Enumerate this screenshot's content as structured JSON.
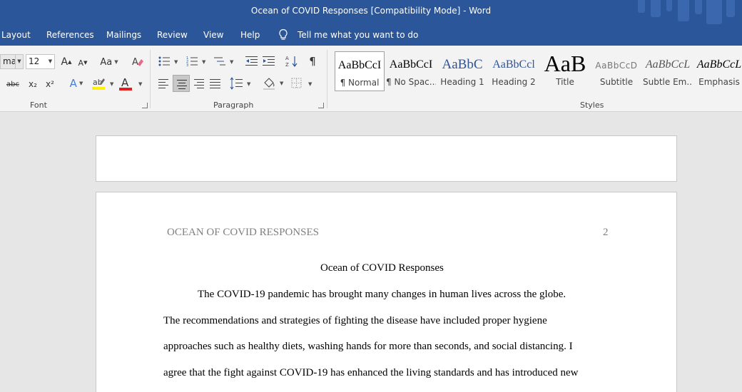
{
  "window": {
    "title": "Ocean of COVID Responses [Compatibility Mode]  -  Word"
  },
  "menu": {
    "items": [
      "Layout",
      "References",
      "Mailings",
      "Review",
      "View",
      "Help"
    ],
    "tell_me": "Tell me what you want to do"
  },
  "ribbon": {
    "font": {
      "name": "ma",
      "size": "12",
      "group_label": "Font"
    },
    "paragraph": {
      "group_label": "Paragraph"
    },
    "styles": {
      "group_label": "Styles",
      "items": [
        {
          "preview": "AaBbCcI",
          "name": "¶ Normal"
        },
        {
          "preview": "AaBbCcI",
          "name": "¶ No Spac..."
        },
        {
          "preview": "AaBbC",
          "name": "Heading 1"
        },
        {
          "preview": "AaBbCcl",
          "name": "Heading 2"
        },
        {
          "preview": "AaB",
          "name": "Title"
        },
        {
          "preview": "AaBbCcD",
          "name": "Subtitle"
        },
        {
          "preview": "AaBbCcL",
          "name": "Subtle Em..."
        },
        {
          "preview": "AaBbCcL",
          "name": "Emphasis"
        }
      ]
    },
    "glyphs": {
      "grow": "A",
      "shrink": "A",
      "case": "Aa",
      "strike": "abc",
      "sub": "x₂",
      "sup": "x²",
      "text_effect": "A",
      "font_color": "A",
      "pilcrow": "¶"
    }
  },
  "colors": {
    "brand": "#2b579a",
    "font_color_bar": "#e02020",
    "highlight_bar": "#ffef00"
  },
  "document": {
    "header_title": "OCEAN OF COVID RESPONSES",
    "page_number": "2",
    "title": "Ocean of COVID Responses",
    "lines": [
      "The COVID-19 pandemic has brought many changes in human lives across the globe.",
      "The recommendations and strategies of fighting the disease have included proper hygiene",
      "approaches such as healthy diets, washing hands for more than seconds, and social distancing. I",
      "agree that the fight against COVID-19 has enhanced the living standards and has introduced new"
    ]
  }
}
